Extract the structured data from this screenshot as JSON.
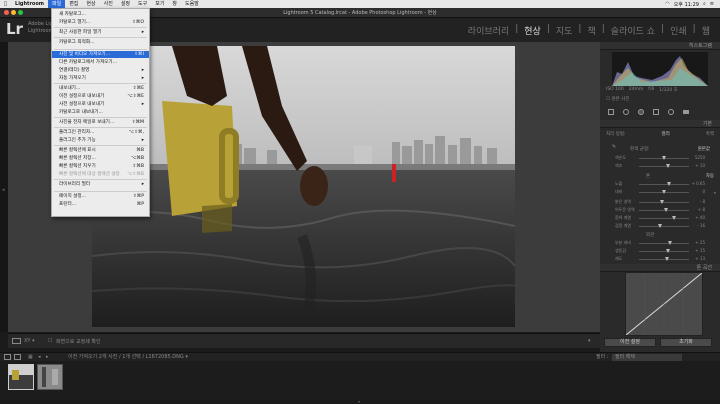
{
  "menubar": {
    "apple": "",
    "items": [
      "Lightroom",
      "파일",
      "편집",
      "현상",
      "사진",
      "설정",
      "도구",
      "보기",
      "창",
      "도움말"
    ],
    "clock": "오후 11:29"
  },
  "window": {
    "title": "Lightroom 5 Catalog.lrcat - Adobe Photoshop Lightroom - 현상"
  },
  "identity": {
    "logo": "Lr",
    "line1": "Adobe Lightr...",
    "line2": "Lightroom..."
  },
  "modules": [
    "라이브러리",
    "현상",
    "지도",
    "책",
    "슬라이드 쇼",
    "인쇄",
    "웹"
  ],
  "active_module": "현상",
  "file_menu": [
    {
      "label": "새 카탈로그...",
      "shortcut": ""
    },
    {
      "label": "카탈로그 열기...",
      "shortcut": "⇧⌘O"
    },
    {
      "label": "최근 사용한 파일 열기",
      "shortcut": "▸"
    },
    {
      "label": "카탈로그 최적화...",
      "shortcut": ""
    },
    {
      "label": "사진 및 비디오 가져오기...",
      "shortcut": "⇧⌘I",
      "highlight": true
    },
    {
      "label": "다른 카탈로그에서 가져오기...",
      "shortcut": ""
    },
    {
      "label": "연결(테더) 촬영",
      "shortcut": "▸"
    },
    {
      "label": "자동 가져오기",
      "shortcut": "▸"
    },
    {
      "label": "내보내기...",
      "shortcut": "⇧⌘E"
    },
    {
      "label": "이전 설정으로 내보내기",
      "shortcut": "⌥⇧⌘E"
    },
    {
      "label": "사전 설정으로 내보내기",
      "shortcut": "▸"
    },
    {
      "label": "카탈로그로 내보내기...",
      "shortcut": ""
    },
    {
      "label": "사진을 전자 메일로 보내기...",
      "shortcut": "⇧⌘M"
    },
    {
      "label": "플러그인 관리자...",
      "shortcut": "⌥⇧⌘,"
    },
    {
      "label": "플러그인 추가 기능",
      "shortcut": "▸"
    },
    {
      "label": "빠른 컬렉션에 표시",
      "shortcut": "⌘B"
    },
    {
      "label": "빠른 컬렉션 저장...",
      "shortcut": "⌥⌘B"
    },
    {
      "label": "빠른 컬렉션 지우기",
      "shortcut": "⇧⌘B"
    },
    {
      "label": "빠른 컬렉션에 대상 컬렉션 설정",
      "shortcut": "⌥⇧⌘B",
      "disabled": true
    },
    {
      "label": "라이브러리 필터",
      "shortcut": "▸"
    },
    {
      "label": "페이지 설정...",
      "shortcut": "⇧⌘P"
    },
    {
      "label": "프린터...",
      "shortcut": "⌘P"
    }
  ],
  "panels": {
    "histogram": "히스토그램",
    "iso": "ISO 100",
    "focal": "24mm",
    "aperture": "f/8",
    "shutter": "1/320 초",
    "original": "원본 사진",
    "basic": "기본",
    "treatment_label": "처리 방법:",
    "color": "컬러",
    "bw": "흑백",
    "profile_label": "프로필:",
    "wb_label": "흰색 균형:",
    "wb_value": "원본값",
    "temp": "색온도",
    "temp_val": "5250",
    "tint": "색조",
    "tint_val": "+ 10",
    "tone": "톤",
    "auto": "자동",
    "exposure": "노출",
    "exposure_val": "+ 0.65",
    "contrast": "대비",
    "contrast_val": "0",
    "highlights": "밝은 영역",
    "highlights_val": "- 8",
    "shadows": "어두운 영역",
    "shadows_val": "+ 8",
    "whites": "흰색 계열",
    "whites_val": "+ 40",
    "blacks": "검정 계열",
    "blacks_val": "- 16",
    "presence": "외관",
    "clarity": "부분 대비",
    "clarity_val": "+ 25",
    "vibrance": "생동감",
    "vibrance_val": "+ 15",
    "saturation": "채도",
    "saturation_val": "+ 13",
    "curve": "톤 곡선",
    "prev_btn": "이전 설정",
    "reset_btn": "초기화"
  },
  "toolbar": {
    "soft_proof": "화면으로 교정쇄 확인"
  },
  "filmstrip": {
    "info": "이전 가져오기   2개 사진 / 1개 선택 / L1672085.DNG ▾",
    "filter_label": "필터 :",
    "filter_value": "필터 해제"
  }
}
